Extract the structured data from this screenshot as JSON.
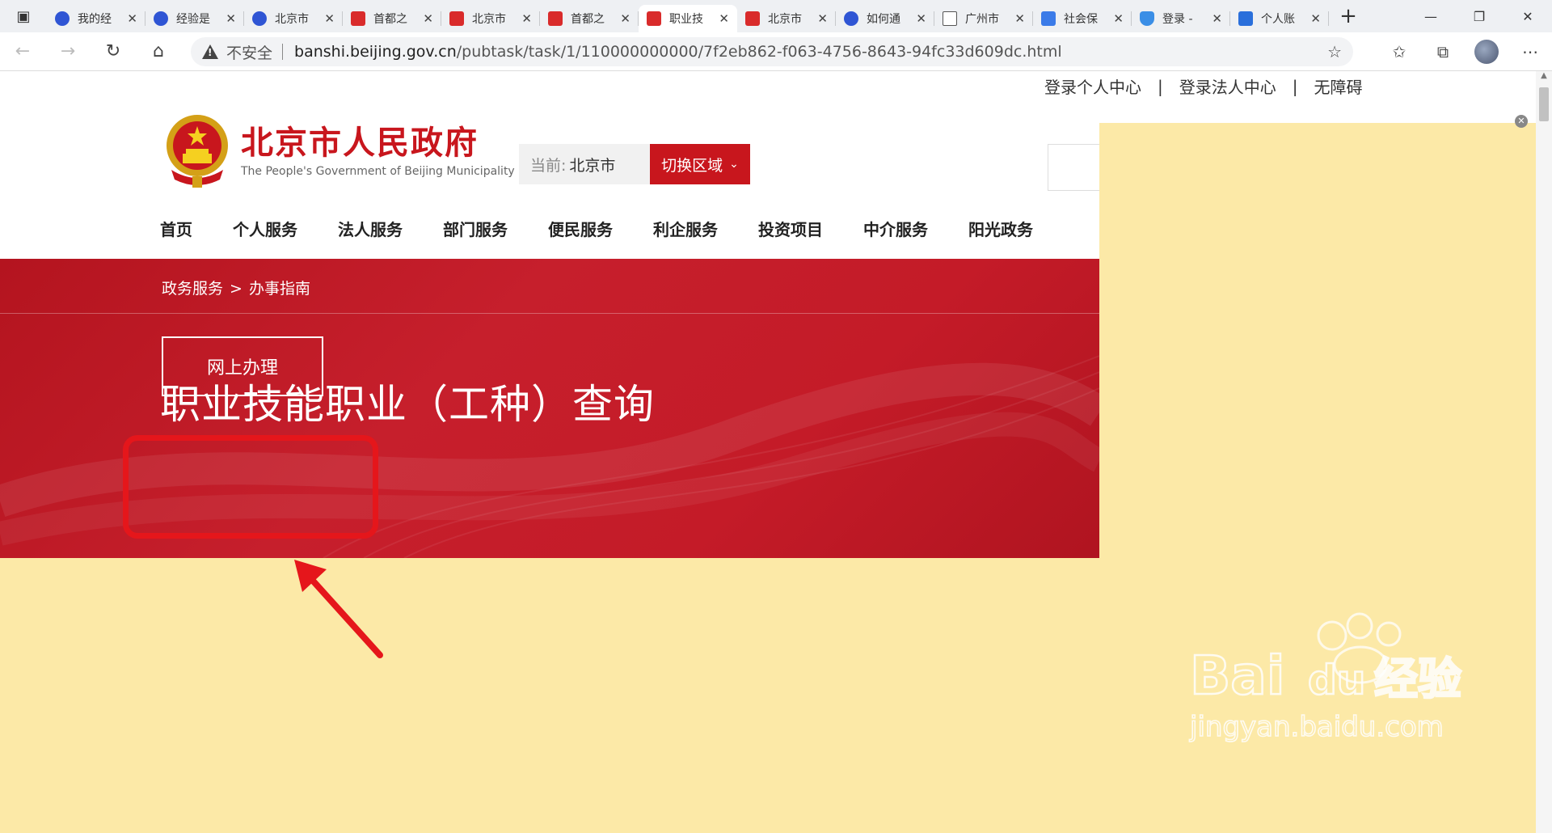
{
  "tabs": [
    {
      "title": "我的经",
      "icon": "baidu-paw-icon",
      "active": false
    },
    {
      "title": "经验是",
      "icon": "baidu-paw-icon",
      "active": false
    },
    {
      "title": "北京市",
      "icon": "baidu-paw-icon",
      "active": false
    },
    {
      "title": "首都之",
      "icon": "gov-icon",
      "active": false
    },
    {
      "title": "北京市",
      "icon": "gov-icon",
      "active": false
    },
    {
      "title": "首都之",
      "icon": "gov-icon",
      "active": false
    },
    {
      "title": "职业技",
      "icon": "gov-icon",
      "active": true
    },
    {
      "title": "北京市",
      "icon": "gov-icon",
      "active": false
    },
    {
      "title": "如何通",
      "icon": "baidu-paw-icon",
      "active": false
    },
    {
      "title": "广州市",
      "icon": "document-icon",
      "active": false
    },
    {
      "title": "社会保",
      "icon": "blue-flower-icon",
      "active": false
    },
    {
      "title": "登录 -",
      "icon": "shield-icon",
      "active": false
    },
    {
      "title": "个人账",
      "icon": "card-icon",
      "active": false
    }
  ],
  "address": {
    "security_label": "不安全",
    "host": "banshi.beijing.gov.cn",
    "path": "/pubtask/task/1/110000000000/7f2eb862-f063-4756-8643-94fc33d609dc.html"
  },
  "site": {
    "top_links": [
      "登录个人中心",
      "登录法人中心",
      "无障碍"
    ],
    "title": "北京市人民政府",
    "subtitle": "The People's Government of Beijing Municipality",
    "region_label": "当前:",
    "region_value": "北京市",
    "region_switch": "切换区域",
    "nav": [
      "首页",
      "个人服务",
      "法人服务",
      "部门服务",
      "便民服务",
      "利企服务",
      "投资项目",
      "中介服务",
      "阳光政务"
    ],
    "breadcrumb": [
      "政务服务",
      "办事指南"
    ],
    "breadcrumb_sep": ">",
    "page_title": "职业技能职业（工种）查询",
    "online_button": "网上办理"
  },
  "watermark": {
    "brand": "Bai",
    "brand_suffix": "du",
    "cn": "经验",
    "url": "jingyan.baidu.com"
  },
  "colors": {
    "accent_red": "#c8161d",
    "annotation_red": "#e5161b",
    "overlay_yellow": "#fce9a7"
  }
}
